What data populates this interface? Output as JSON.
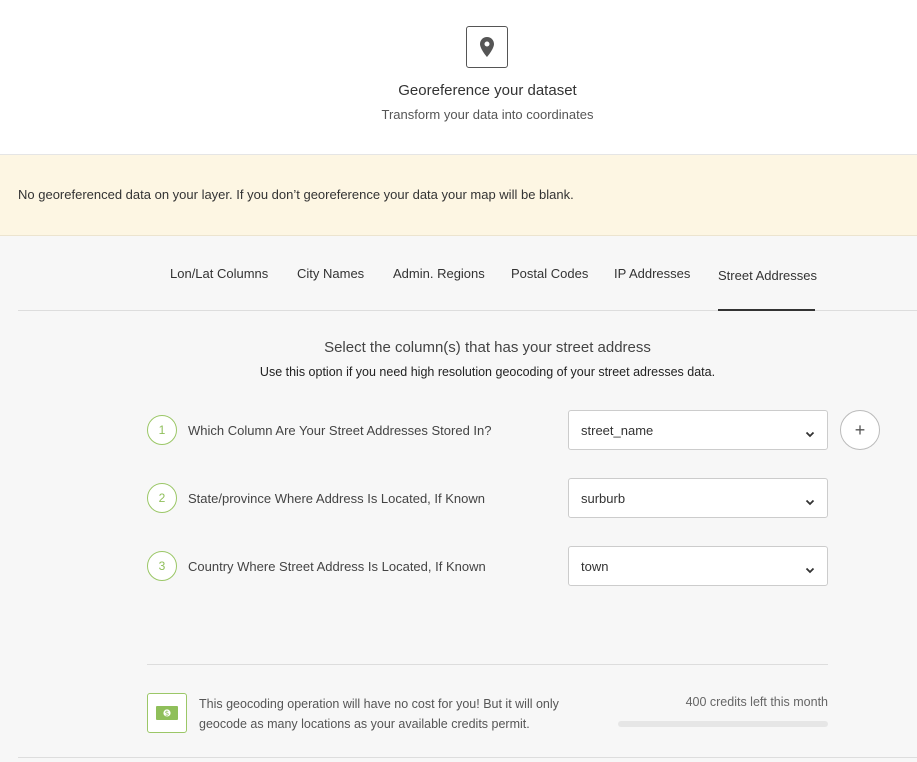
{
  "header": {
    "icon": "map-pin-icon",
    "title": "Georeference your dataset",
    "subtitle": "Transform your data into coordinates"
  },
  "warning": {
    "text": "No georeferenced data on your layer. If you don’t georeference your data your map will be blank."
  },
  "tabs": [
    {
      "label": "Lon/Lat Columns",
      "active": false
    },
    {
      "label": "City Names",
      "active": false
    },
    {
      "label": "Admin. Regions",
      "active": false
    },
    {
      "label": "Postal Codes",
      "active": false
    },
    {
      "label": "IP Addresses",
      "active": false
    },
    {
      "label": "Street Addresses",
      "active": true
    }
  ],
  "section": {
    "title": "Select the column(s) that has your street address",
    "subtitle": "Use this option if you need high resolution geocoding of your street adresses data."
  },
  "steps": [
    {
      "number": "1",
      "label": "Which Column Are Your Street Addresses Stored In?",
      "value": "street_name"
    },
    {
      "number": "2",
      "label": "State/province Where Address Is Located, If Known",
      "value": "surburb"
    },
    {
      "number": "3",
      "label": "Country Where Street Address Is Located, If Known",
      "value": "town"
    }
  ],
  "add_button": "+",
  "cost": {
    "icon": "money-bill-icon",
    "text": "This geocoding operation will have no cost for you! But it will only geocode as many locations as your available credits permit.",
    "credits_text": "400 credits left this month",
    "credits_used_fraction": 0
  },
  "colors": {
    "accent_green": "#9bc767",
    "warning_bg": "#fdf6e3"
  }
}
